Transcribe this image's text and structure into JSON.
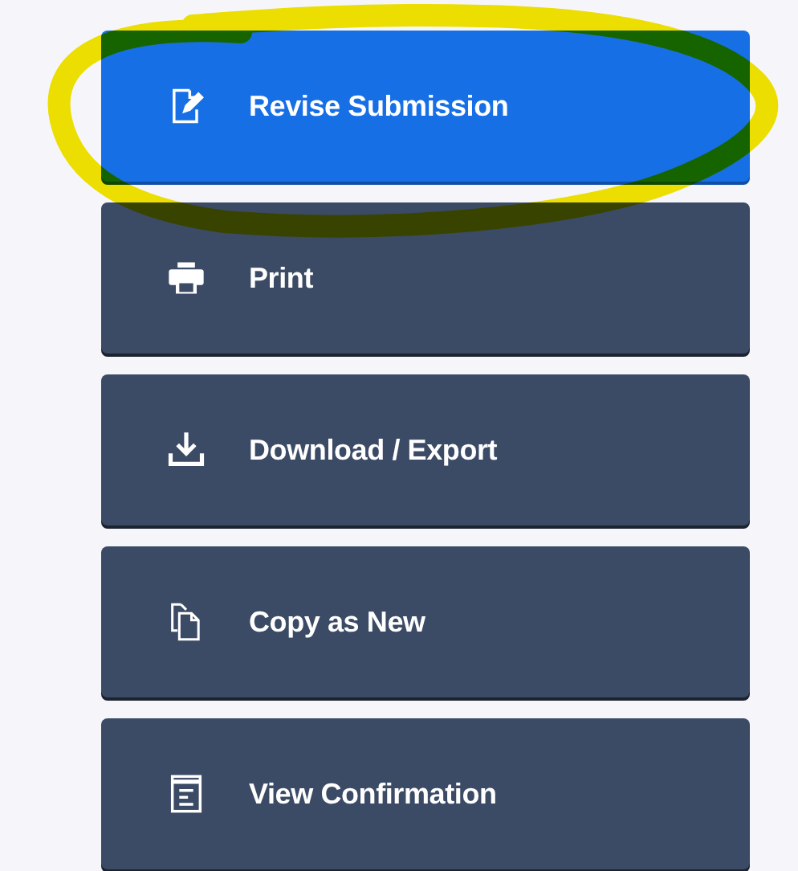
{
  "actions": [
    {
      "kind": "revise",
      "label": "Revise Submission",
      "selected": true,
      "highlighted": true
    },
    {
      "kind": "print",
      "label": "Print",
      "selected": false,
      "highlighted": false
    },
    {
      "kind": "download",
      "label": "Download / Export",
      "selected": false,
      "highlighted": false
    },
    {
      "kind": "copy",
      "label": "Copy as New",
      "selected": false,
      "highlighted": false
    },
    {
      "kind": "confirmation",
      "label": "View Confirmation",
      "selected": false,
      "highlighted": false
    }
  ]
}
